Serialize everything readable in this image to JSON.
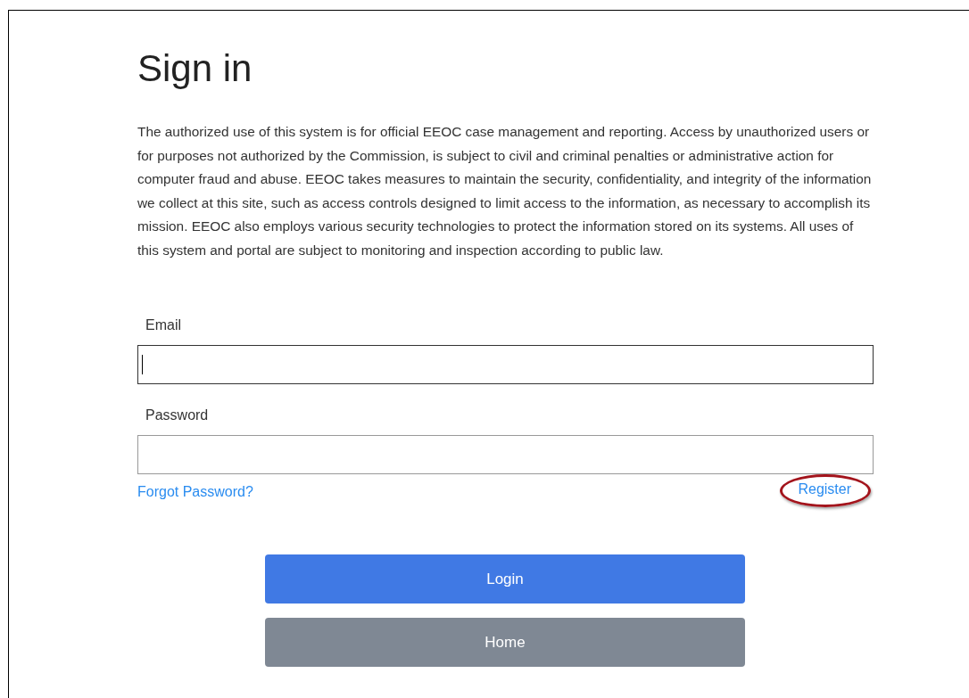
{
  "title": "Sign in",
  "notice": "The authorized use of this system is for official EEOC case management and reporting. Access by unauthorized users or for purposes not authorized by the Commission, is subject to civil and criminal penalties or administrative action for computer fraud and abuse. EEOC takes measures to maintain the security, confidentiality, and integrity of the information we collect at this site, such as access controls designed to limit access to the information, as necessary to accomplish its mission. EEOC also employs various security technologies to protect the information stored on its systems. All uses of this system and portal are subject to monitoring and inspection according to public law.",
  "fields": [
    {
      "label": "Email",
      "focused": true
    },
    {
      "label": "Password",
      "focused": false
    }
  ],
  "links": {
    "forgot": "Forgot Password?",
    "register": {
      "text": "Register",
      "circled": true
    }
  },
  "buttons": [
    {
      "label": "Login",
      "kind": "primary"
    },
    {
      "label": "Home",
      "kind": "secondary"
    }
  ]
}
